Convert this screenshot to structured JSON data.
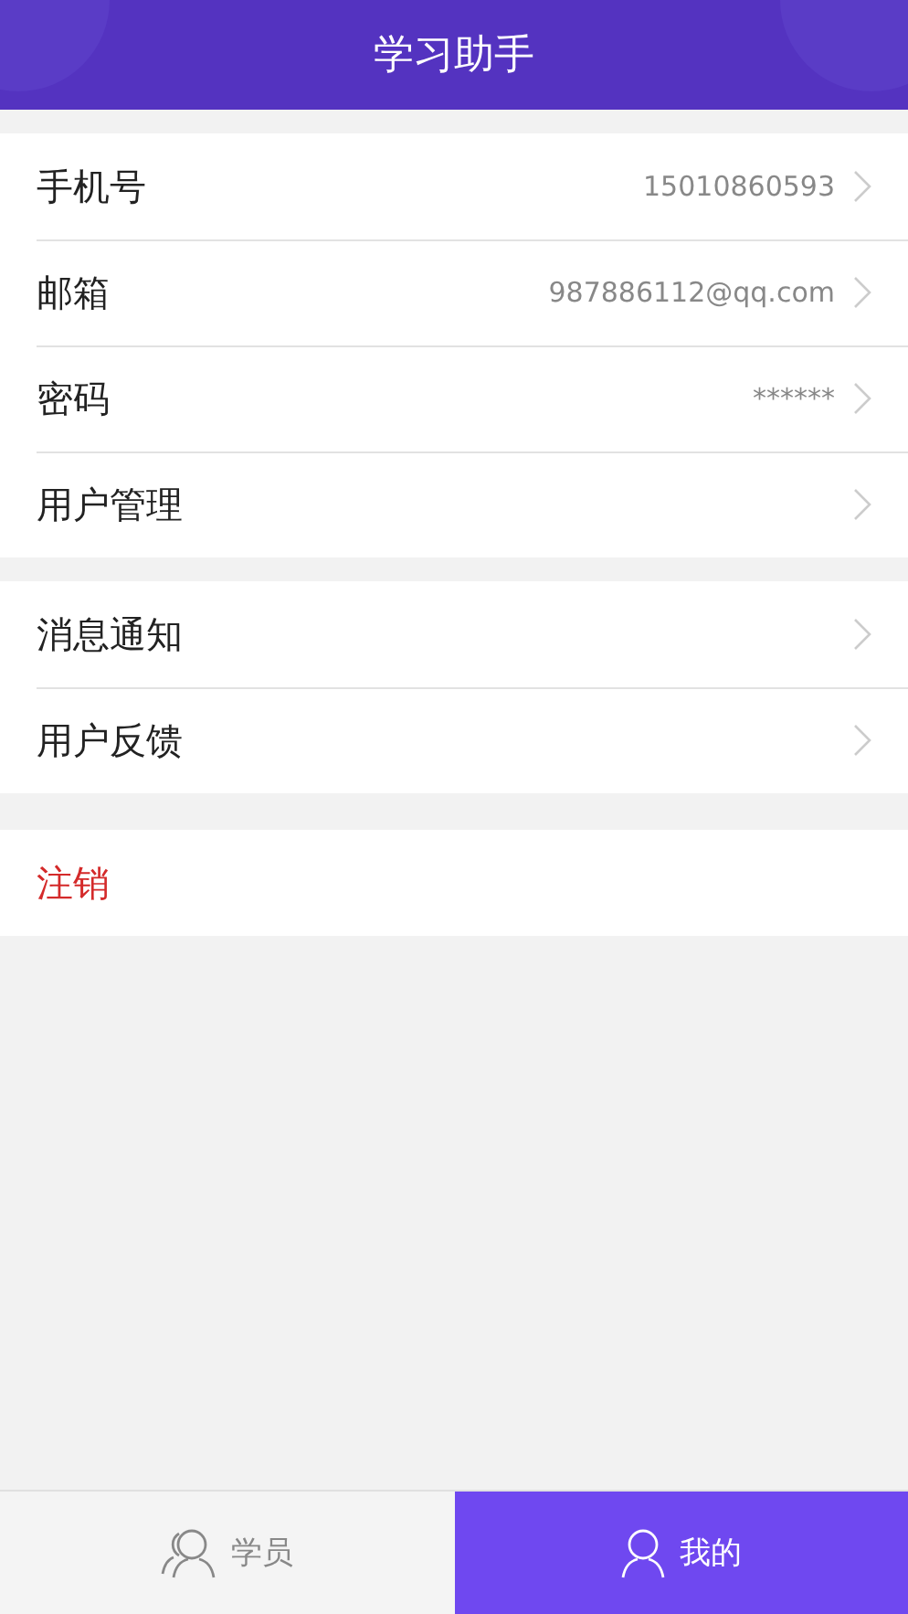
{
  "header": {
    "title": "学习助手"
  },
  "groups": [
    {
      "items": [
        {
          "kind": "link",
          "label": "手机号",
          "value": "15010860593"
        },
        {
          "kind": "link",
          "label": "邮箱",
          "value": "987886112@qq.com"
        },
        {
          "kind": "link",
          "label": "密码",
          "value": "******"
        },
        {
          "kind": "link",
          "label": "用户管理"
        }
      ]
    },
    {
      "items": [
        {
          "kind": "link",
          "label": "消息通知"
        },
        {
          "kind": "link",
          "label": "用户反馈"
        }
      ]
    },
    {
      "items": [
        {
          "kind": "danger",
          "label": "注销"
        }
      ]
    }
  ],
  "tabs": [
    {
      "label": "学员",
      "kind": "group",
      "selected": false
    },
    {
      "label": "我的",
      "kind": "person",
      "selected": true
    }
  ]
}
